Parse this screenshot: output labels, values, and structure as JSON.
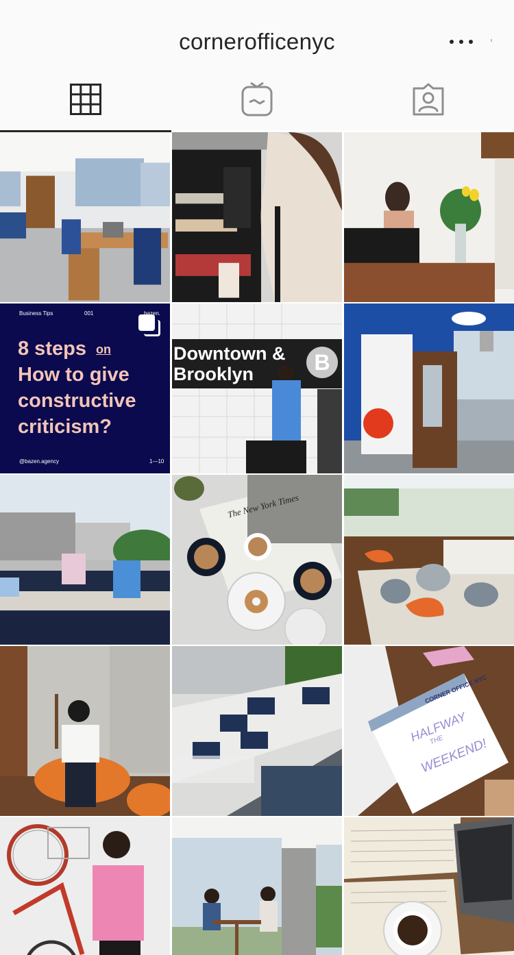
{
  "profile": {
    "username": "cornerofficenyc"
  },
  "icons": {
    "more": "more-horizontal-icon",
    "tab_grid": "grid-icon",
    "tab_igtv": "igtv-icon",
    "tab_tagged": "tagged-user-icon",
    "carousel": "carousel-multiple-icon"
  },
  "posts": [
    {
      "id": 1,
      "kind": "photo"
    },
    {
      "id": 2,
      "kind": "photo"
    },
    {
      "id": 3,
      "kind": "photo"
    },
    {
      "id": 4,
      "kind": "graphic",
      "header_left": "Business Tips",
      "header_num": "001",
      "brand": "bazen.",
      "line1": "8 steps",
      "line1_small": "on",
      "line2": "How to give",
      "line3": "constructive",
      "line4": "criticism?",
      "handle": "@bazen.agency",
      "page": "1—10"
    },
    {
      "id": 5,
      "kind": "photo",
      "sign_line1": "Downtown &",
      "sign_line2": "Brooklyn",
      "sign_letter": "B"
    },
    {
      "id": 6,
      "kind": "photo"
    },
    {
      "id": 7,
      "kind": "photo"
    },
    {
      "id": 8,
      "kind": "photo",
      "newspaper": "The New York Times"
    },
    {
      "id": 9,
      "kind": "photo"
    },
    {
      "id": 10,
      "kind": "photo"
    },
    {
      "id": 11,
      "kind": "photo"
    },
    {
      "id": 12,
      "kind": "photo",
      "card_brand": "CORNER OFFICE NYC",
      "card_line1": "HALFWAY",
      "card_line2": "THE",
      "card_line3": "WEEKEND!"
    },
    {
      "id": 13,
      "kind": "photo"
    },
    {
      "id": 14,
      "kind": "photo"
    },
    {
      "id": 15,
      "kind": "photo"
    }
  ],
  "colors": {
    "header_bg": "#fafafa",
    "text": "#262626",
    "graphic_bg": "#0b0a4e",
    "graphic_text": "#f4c4b8"
  }
}
